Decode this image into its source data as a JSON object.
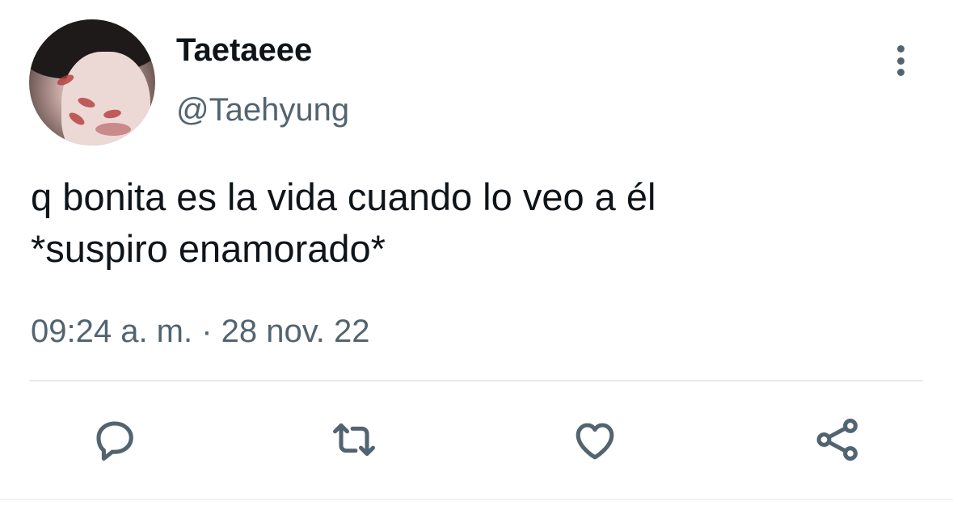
{
  "tweet": {
    "author": {
      "display_name": "Taetaeee",
      "handle": "@Taehyung"
    },
    "text_lines": [
      "q bonita es la vida cuando lo veo a él",
      "*suspiro enamorado*"
    ],
    "timestamp": "09:24 a. m. · 28 nov. 22"
  },
  "actions": {
    "reply_icon": "reply-bubble-icon",
    "retweet_icon": "retweet-arrows-icon",
    "like_icon": "heart-icon",
    "share_icon": "share-nodes-icon"
  },
  "colors": {
    "text": "#0f1419",
    "secondary": "#536471",
    "divider": "#e7eaee"
  }
}
